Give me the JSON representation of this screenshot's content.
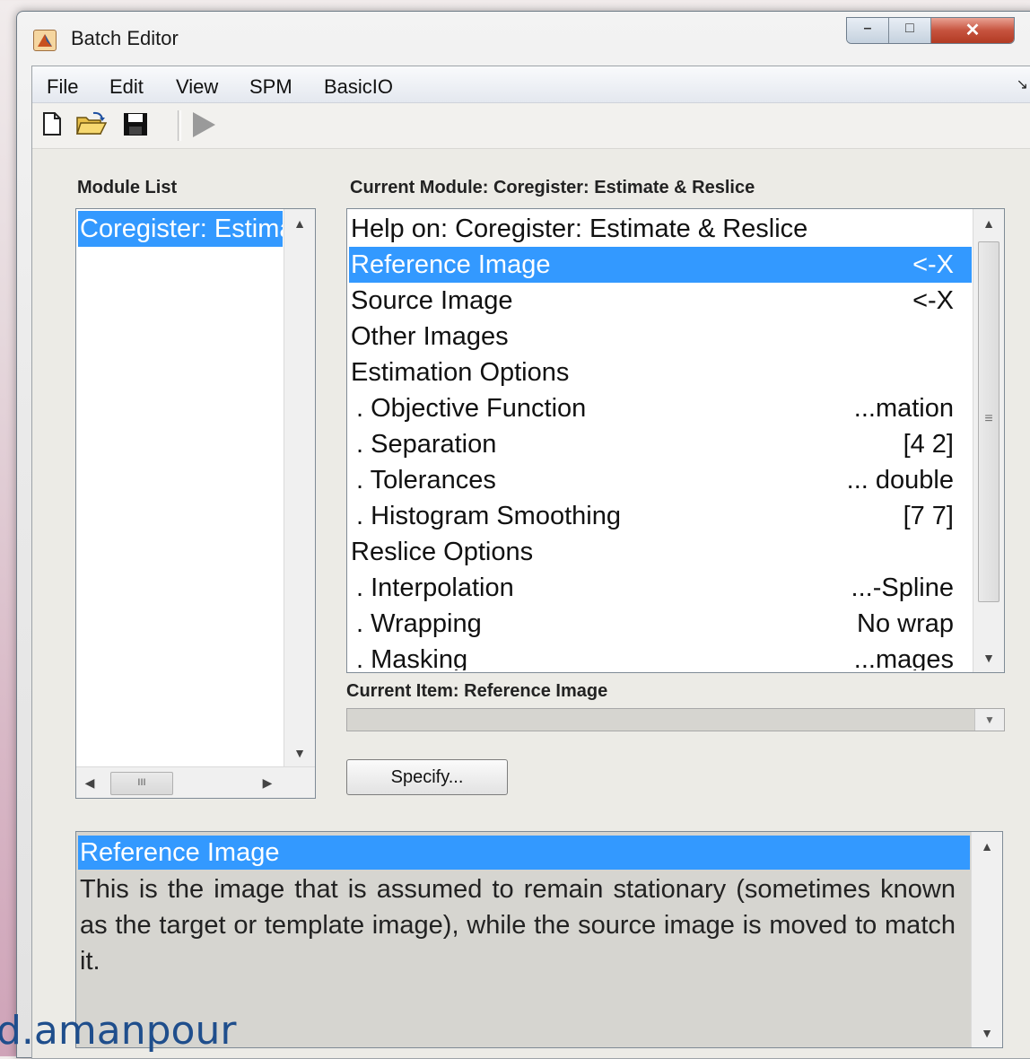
{
  "window": {
    "title": "Batch Editor",
    "controls": {
      "minimize": "–",
      "maximize": "□",
      "close": "✕"
    }
  },
  "menubar": {
    "items": [
      "File",
      "Edit",
      "View",
      "SPM",
      "BasicIO"
    ],
    "corner": "↘"
  },
  "toolbar": {
    "icons": [
      "new-file-icon",
      "open-folder-icon",
      "save-icon",
      "run-icon"
    ]
  },
  "module_list": {
    "label": "Module List",
    "items": [
      {
        "text": "Coregister: Estimate & Reslice",
        "selected": true
      }
    ]
  },
  "current_module": {
    "label": "Current Module: Coregister: Estimate & Reslice",
    "rows": [
      {
        "label": "Help on: Coregister: Estimate & Reslice",
        "value": ""
      },
      {
        "label": "Reference Image",
        "value": "<-X",
        "selected": true
      },
      {
        "label": "Source Image",
        "value": "<-X"
      },
      {
        "label": "Other Images",
        "value": ""
      },
      {
        "label": "Estimation Options",
        "value": ""
      },
      {
        "label": ". Objective Function",
        "value": "...mation"
      },
      {
        "label": ". Separation",
        "value": "[4 2]"
      },
      {
        "label": ". Tolerances",
        "value": "... double"
      },
      {
        "label": ". Histogram Smoothing",
        "value": "[7 7]"
      },
      {
        "label": "Reslice Options",
        "value": ""
      },
      {
        "label": ". Interpolation",
        "value": "...-Spline"
      },
      {
        "label": ". Wrapping",
        "value": "No wrap"
      },
      {
        "label": ". Masking",
        "value": "...mages"
      }
    ]
  },
  "current_item": {
    "label": "Current Item: Reference Image"
  },
  "specify_button": {
    "label": "Specify..."
  },
  "help": {
    "title": "Reference Image",
    "body": "This is the image that is assumed to remain stationary (sometimes known as the target or template image), while the source image is moved to match it."
  },
  "watermark": {
    "text": "d.amanpour"
  },
  "colors": {
    "selection": "#3399ff",
    "panel": "#ecebe6",
    "watermark": "#1f4e8c"
  }
}
